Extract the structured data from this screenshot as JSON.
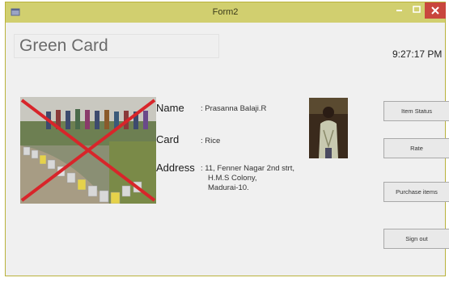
{
  "window": {
    "title": "Form2"
  },
  "header": {
    "title": "Green Card",
    "time": "9:27:17 PM"
  },
  "details": {
    "name_label": "Name",
    "name_value": ": Prasanna Balaji.R",
    "card_label": "Card",
    "card_value": ": Rice",
    "address_label": "Address",
    "address_lines": [
      ": 11, Fenner Nagar 2nd strt,",
      "H.M.S Colony,",
      "Madurai-10."
    ]
  },
  "buttons": {
    "item_status": "Item Status",
    "rate": "Rate",
    "purchase_items": "Purchase items",
    "sign_out": "Sign out"
  },
  "colors": {
    "titlebar": "#d1cf6f",
    "close_button": "#c9463d",
    "cross_mark": "#d8252a"
  }
}
